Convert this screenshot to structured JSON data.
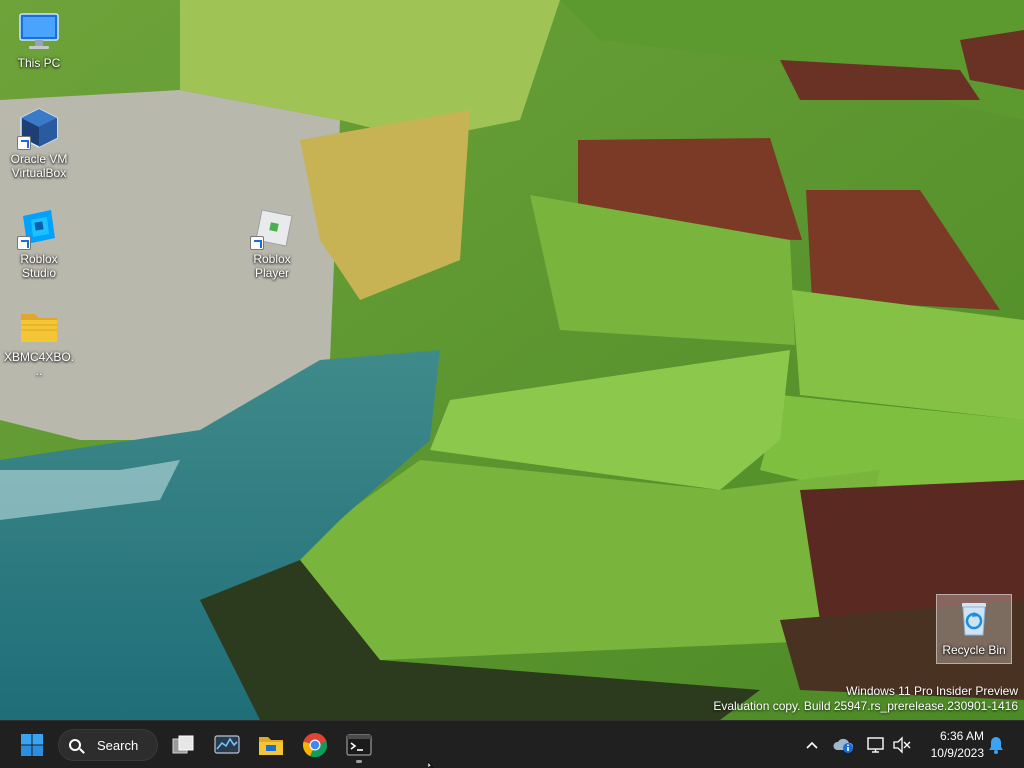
{
  "desktop": {
    "icons": [
      {
        "label": "This PC",
        "icon": "monitor-icon"
      },
      {
        "label": "Oracle VM VirtualBox",
        "icon": "virtualbox-icon"
      },
      {
        "label": "Roblox Studio",
        "icon": "roblox-studio-icon"
      },
      {
        "label": "Roblox Player",
        "icon": "roblox-player-icon"
      },
      {
        "label": "XBMC4XBO...",
        "icon": "folder-icon"
      },
      {
        "label": "Recycle Bin",
        "icon": "recycle-bin-icon"
      }
    ]
  },
  "watermark": {
    "line1": "Windows 11 Pro Insider Preview",
    "line2": "Evaluation copy. Build 25947.rs_prerelease.230901-1416"
  },
  "taskbar": {
    "search_label": "Search",
    "apps": [
      {
        "name": "Start",
        "icon": "windows-start-icon"
      },
      {
        "name": "Task View",
        "icon": "task-view-icon"
      },
      {
        "name": "Resource Monitor",
        "icon": "resource-monitor-icon"
      },
      {
        "name": "File Explorer",
        "icon": "file-explorer-icon"
      },
      {
        "name": "Google Chrome",
        "icon": "chrome-icon"
      },
      {
        "name": "Terminal",
        "icon": "terminal-icon",
        "running": true
      }
    ],
    "tray": {
      "time": "6:36 AM",
      "date": "10/9/2023"
    }
  },
  "colors": {
    "taskbar_bg": "#202020",
    "accent": "#1a6fd6",
    "folder": "#f4c534",
    "chrome_red": "#db4437",
    "chrome_yellow": "#f4b400",
    "chrome_green": "#0f9d58",
    "chrome_blue": "#4285f4"
  }
}
